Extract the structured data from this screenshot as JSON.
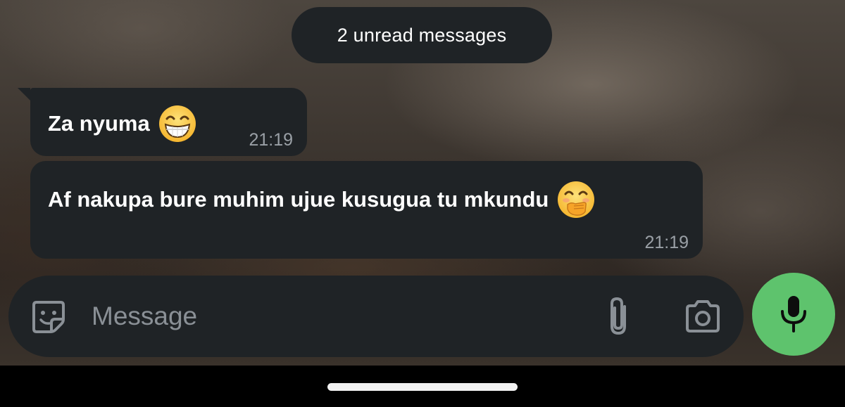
{
  "unread": {
    "label": "2 unread messages"
  },
  "messages": [
    {
      "text": "Za nyuma",
      "emoji": "grinning-face-with-smiling-eyes-emoji",
      "time": "21:19"
    },
    {
      "text": "Af nakupa bure muhim ujue kusugua tu mkundu",
      "emoji": "face-with-hand-over-mouth-emoji",
      "time": "21:19"
    }
  ],
  "composer": {
    "placeholder": "Message",
    "value": "",
    "icons": [
      "sticker-icon",
      "paperclip-icon",
      "camera-icon",
      "microphone-icon"
    ]
  },
  "colors": {
    "bubble": "#1f2326",
    "accent": "#5ec36d",
    "time": "#9aa0a6",
    "placeholder": "#8a9096"
  }
}
